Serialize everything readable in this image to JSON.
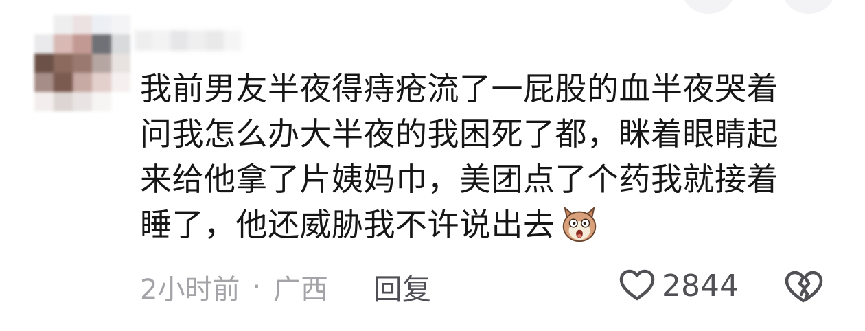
{
  "comment": {
    "text_lines": [
      "我前男友半夜得痔疮流了一屁股的血半夜哭着",
      "问我怎么办大半夜的我困死了都，眯着眼睛起",
      "来给他拿了片姨妈巾，美团点了个药我就接着",
      "睡了，他还威胁我不许说出去"
    ],
    "emoji_icon": "shocked-dog-emoji"
  },
  "meta": {
    "time": "2小时前",
    "separator": "·",
    "location": "广西"
  },
  "actions": {
    "reply_label": "回复",
    "like_count": "2844",
    "like_icon": "heart-outline-icon",
    "dislike_icon": "broken-heart-icon"
  },
  "colors": {
    "text": "#161616",
    "meta": "#a3a3a8",
    "icon": "#505055"
  }
}
